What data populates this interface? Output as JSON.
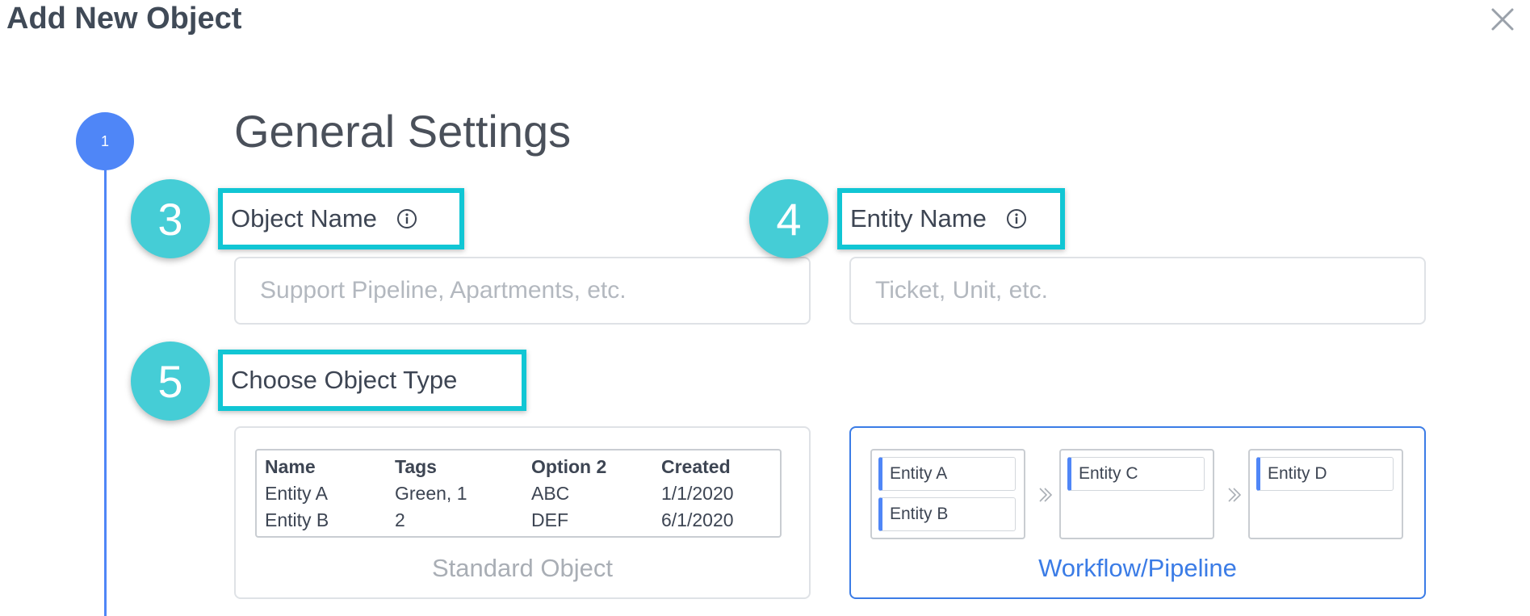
{
  "dialog": {
    "title": "Add New Object"
  },
  "step": {
    "number": "1",
    "title": "General Settings"
  },
  "badges": {
    "object_name": "3",
    "entity_name": "4",
    "object_type": "5"
  },
  "fields": {
    "object_name": {
      "label": "Object Name",
      "placeholder": "Support Pipeline, Apartments, etc.",
      "value": ""
    },
    "entity_name": {
      "label": "Entity Name",
      "placeholder": "Ticket, Unit, etc.",
      "value": ""
    }
  },
  "object_type": {
    "label": "Choose Object Type",
    "options": {
      "standard": {
        "caption": "Standard Object",
        "headers": [
          "Name",
          "Tags",
          "Option 2",
          "Created"
        ],
        "rows": [
          [
            "Entity A",
            "Green, 1",
            "ABC",
            "1/1/2020"
          ],
          [
            "Entity B",
            "2",
            "DEF",
            "6/1/2020"
          ]
        ]
      },
      "workflow": {
        "caption": "Workflow/Pipeline",
        "stages": [
          [
            "Entity A",
            "Entity B"
          ],
          [
            "Entity C"
          ],
          [
            "Entity D"
          ]
        ]
      }
    },
    "selected": "Workflow/Pipeline"
  },
  "colors": {
    "accent": "#4f86f7",
    "highlight": "#11c6d4",
    "badge": "#45cdd6",
    "selected_border": "#3b7ce6",
    "placeholder": "#b3b8bf"
  }
}
